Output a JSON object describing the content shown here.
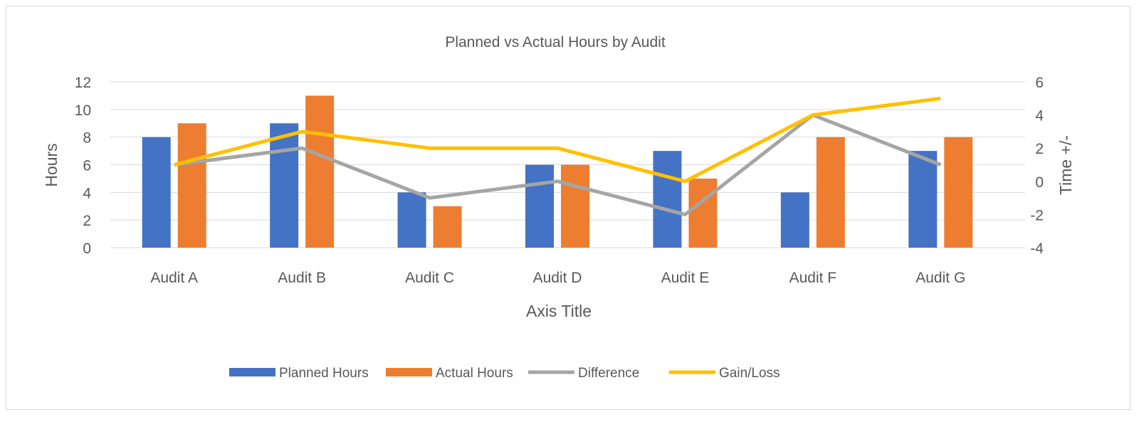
{
  "chart_data": {
    "type": "bar",
    "title": "Planned vs Actual Hours by Audit",
    "xlabel": "Axis Title",
    "ylabel": "Hours",
    "y2label": "Time +/-",
    "categories": [
      "Audit A",
      "Audit B",
      "Audit C",
      "Audit D",
      "Audit E",
      "Audit F",
      "Audit G"
    ],
    "ylim": [
      0,
      12
    ],
    "yticks": [
      0,
      2,
      4,
      6,
      8,
      10,
      12
    ],
    "y2lim": [
      -4,
      6
    ],
    "y2ticks": [
      -4,
      -2,
      0,
      2,
      4,
      6
    ],
    "grid": true,
    "legend_position": "bottom",
    "series": [
      {
        "name": "Planned Hours",
        "kind": "bar",
        "axis": "left",
        "color": "#4472c4",
        "values": [
          8,
          9,
          4,
          6,
          7,
          4,
          7
        ]
      },
      {
        "name": "Actual Hours",
        "kind": "bar",
        "axis": "left",
        "color": "#ed7d31",
        "values": [
          9,
          11,
          3,
          6,
          5,
          8,
          8
        ]
      },
      {
        "name": "Difference",
        "kind": "line",
        "axis": "right",
        "color": "#a5a5a5",
        "values": [
          1,
          2,
          -1,
          0,
          -2,
          4,
          1
        ]
      },
      {
        "name": "Gain/Loss",
        "kind": "line",
        "axis": "right",
        "color": "#ffc000",
        "values": [
          1,
          3,
          2,
          2,
          0,
          4,
          5
        ]
      }
    ]
  }
}
